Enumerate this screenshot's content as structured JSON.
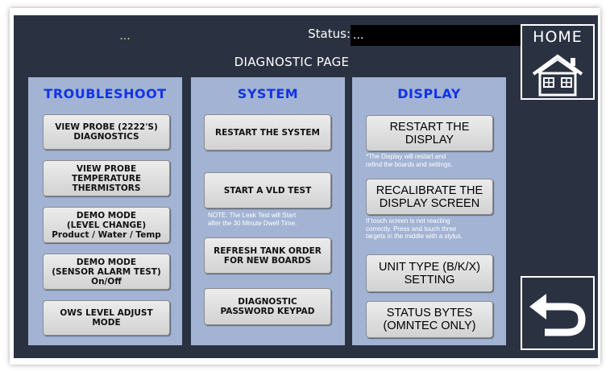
{
  "header": {
    "indicator": "...",
    "status_label": "Status:",
    "status_value": "...",
    "page_title": "DIAGNOSTIC PAGE"
  },
  "colors": {
    "background": "#2a3242",
    "panel": "#a3b3d3",
    "panel_title": "#1233e6",
    "indicator": "#e8e060"
  },
  "troubleshoot": {
    "title": "TROUBLESHOOT",
    "buttons": [
      "VIEW PROBE (2222'S)\nDIAGNOSTICS",
      "VIEW PROBE\nTEMPERATURE\nTHERMISTORS",
      "DEMO MODE\n(LEVEL CHANGE)\nProduct / Water / Temp",
      "DEMO MODE\n(SENSOR ALARM TEST)\nOn/Off",
      "OWS LEVEL ADJUST\nMODE"
    ]
  },
  "system": {
    "title": "SYSTEM",
    "buttons": [
      "RESTART THE SYSTEM",
      "START A VLD TEST",
      "REFRESH TANK ORDER\nFOR NEW BOARDS",
      "DIAGNOSTIC\nPASSWORD KEYPAD"
    ],
    "note": "NOTE: The Leak Test will Start\nafter the 30 Minute Dwell Time."
  },
  "display": {
    "title": "DISPLAY",
    "buttons": [
      "RESTART THE\nDISPLAY",
      "RECALIBRATE THE\nDISPLAY SCREEN",
      "UNIT TYPE (B/K/X)\nSETTING",
      "STATUS BYTES\n(OMNTEC ONLY)"
    ],
    "note_restart": "*The Display will restart and\nrefind the boards and settings.",
    "note_recalibrate": "If touch screen is not reacting\ncorrectly.  Press and touch three\ntargets in the middle with a stylus."
  },
  "nav": {
    "home_label": "HOME",
    "home_icon": "house-icon",
    "back_icon": "back-arrow-icon"
  }
}
